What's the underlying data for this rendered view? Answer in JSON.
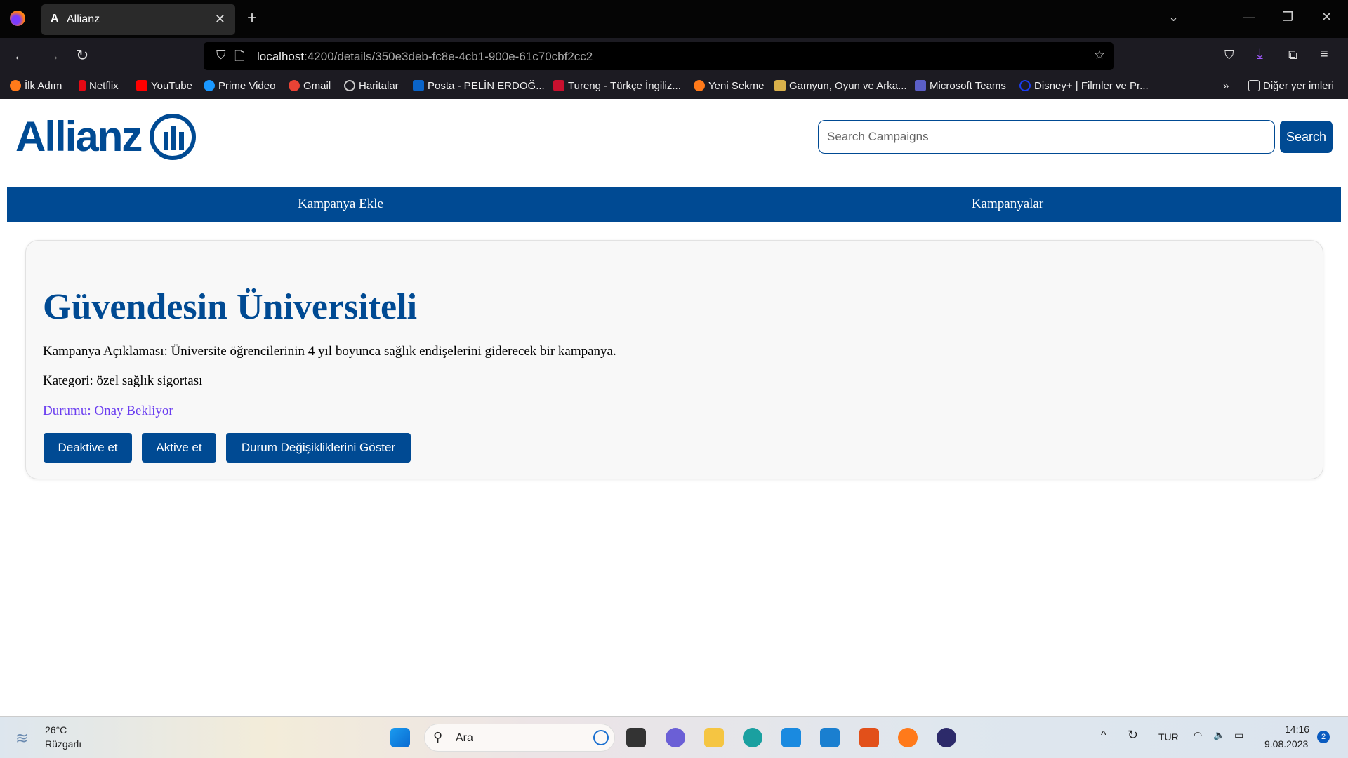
{
  "browser": {
    "tab_title": "Allianz",
    "tab_icon": "A",
    "url_host": "localhost",
    "url_path": ":4200/details/350e3deb-fc8e-4cb1-900e-61c70cbf2cc2",
    "bookmarks": [
      {
        "label": "İlk Adım",
        "color": "#ff7a1a"
      },
      {
        "label": "Netflix",
        "color": "#e50914"
      },
      {
        "label": "YouTube",
        "color": "#ff0000"
      },
      {
        "label": "Prime Video",
        "color": "#1a98ff"
      },
      {
        "label": "Gmail",
        "color": "#ea4335"
      },
      {
        "label": "Haritalar",
        "color": "#888888"
      },
      {
        "label": "Posta - PELİN ERDOĞ...",
        "color": "#0a64c8"
      },
      {
        "label": "Tureng - Türkçe İngiliz...",
        "color": "#c8102e"
      },
      {
        "label": "Yeni Sekme",
        "color": "#ff7a1a"
      },
      {
        "label": "Gamyun, Oyun ve Arka...",
        "color": "#d8b04a"
      },
      {
        "label": "Microsoft Teams",
        "color": "#5b5fc7"
      },
      {
        "label": "Disney+ | Filmler ve Pr...",
        "color": "#1a3cf0"
      }
    ],
    "other_bookmarks": "Diğer yer imleri"
  },
  "header": {
    "logo_text": "Allianz",
    "search_placeholder": "Search Campaigns",
    "search_button": "Search"
  },
  "nav": {
    "items": [
      "Kampanya Ekle",
      "Kampanyalar"
    ]
  },
  "campaign": {
    "title": "Güvendesin Üniversiteli",
    "description": "Kampanya Açıklaması: Üniversite öğrencilerinin 4 yıl boyunca sağlık endişelerini giderecek bir kampanya.",
    "category": "Kategori: özel sağlık sigortası",
    "status": "Durumu: Onay Bekliyor",
    "buttons": [
      "Deaktive et",
      "Aktive et",
      "Durum Değişikliklerini Göster"
    ]
  },
  "colors": {
    "brand": "#004a93",
    "status": "#6a3df0"
  },
  "taskbar": {
    "weather_temp": "26°C",
    "weather_desc": "Rüzgarlı",
    "search_label": "Ara",
    "language": "TUR",
    "time": "14:16",
    "date": "9.08.2023",
    "notifications": "2"
  }
}
